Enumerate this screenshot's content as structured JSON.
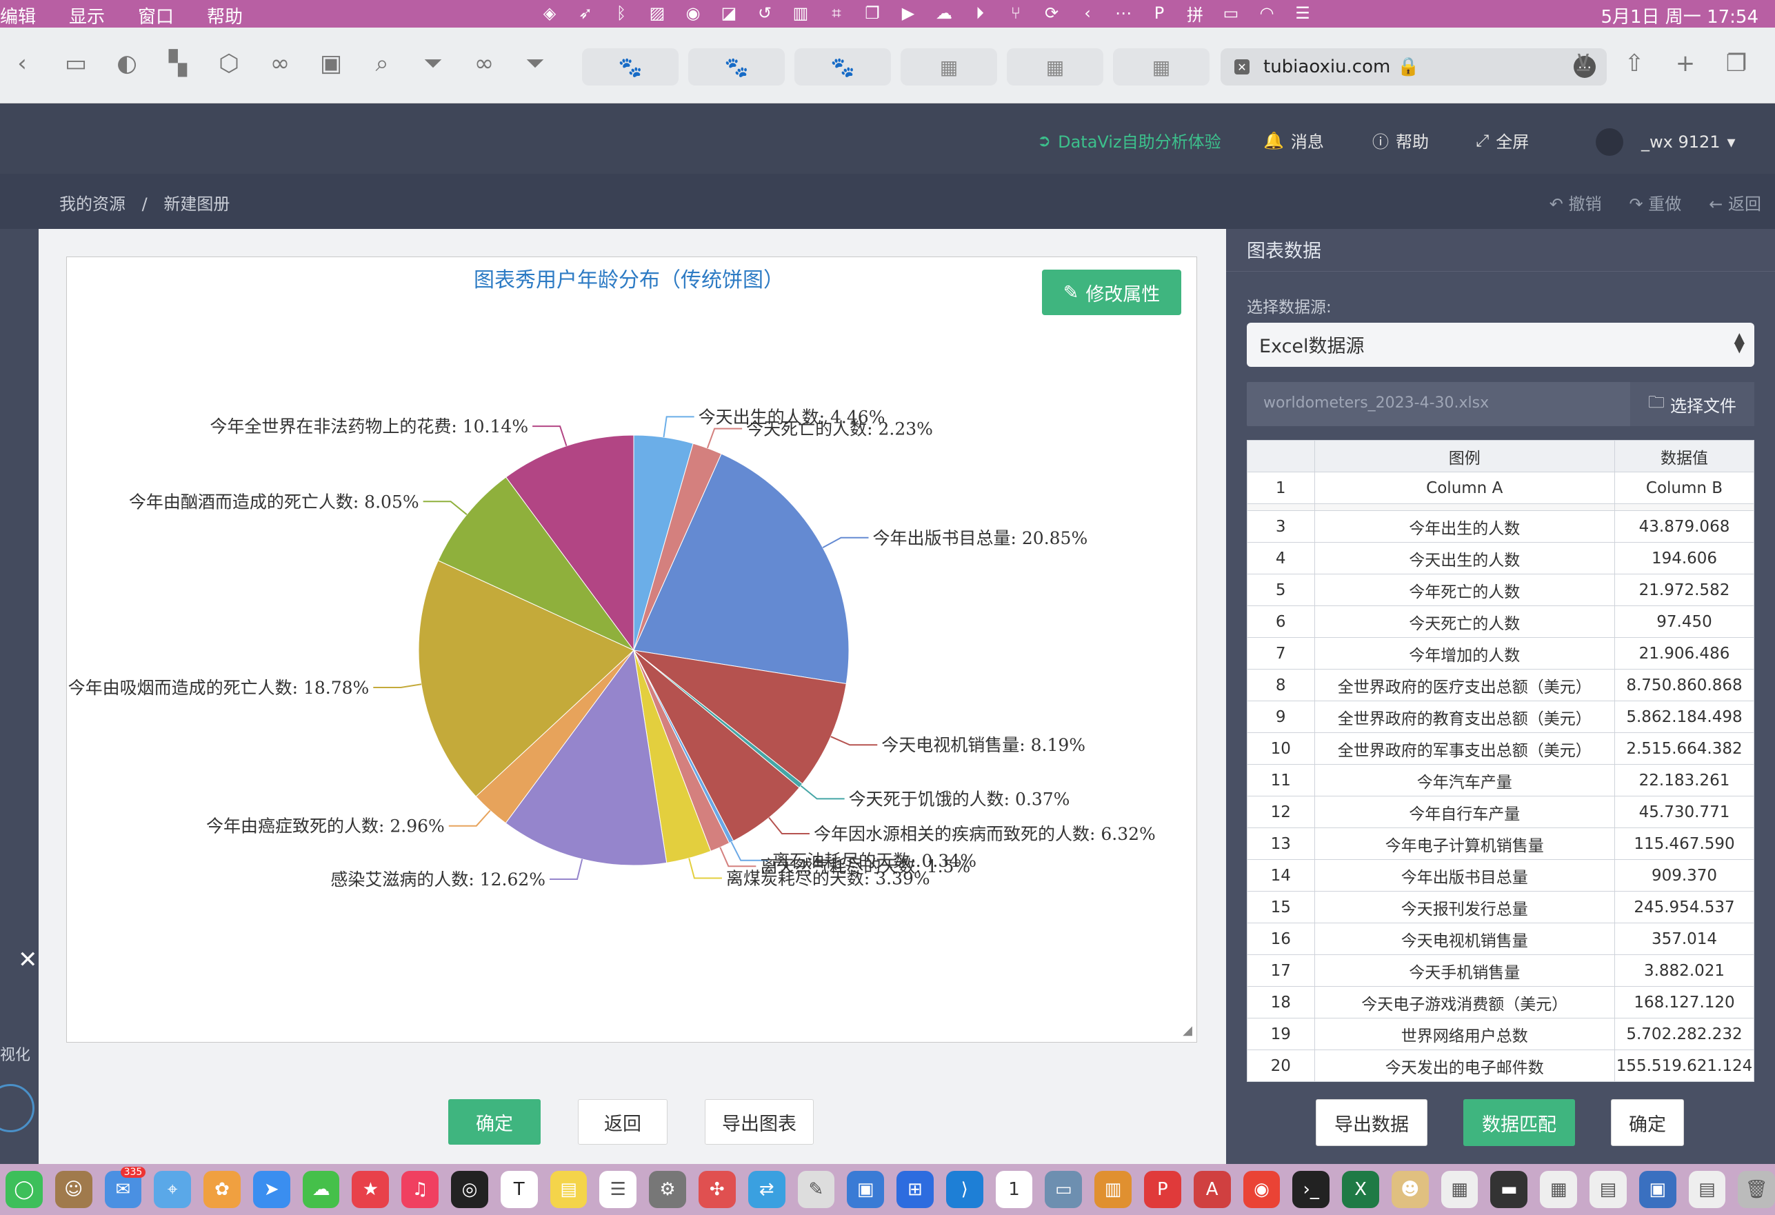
{
  "menubar": {
    "menus": [
      "编辑",
      "显示",
      "窗口",
      "帮助"
    ],
    "clock": "5月1日 周一 17:54"
  },
  "browser": {
    "url": "tubiaoxiu.com"
  },
  "app_header": {
    "dataviz": "DataViz自助分析体验",
    "messages": "消息",
    "help": "帮助",
    "fullscreen": "全屏",
    "user": "_wx 9121"
  },
  "breadcrumb": {
    "root": "我的资源",
    "separator": "/",
    "current": "新建图册",
    "undo": "撤销",
    "redo": "重做",
    "back": "返回"
  },
  "left_strip": {
    "close": "✕",
    "vertical_label": "视化"
  },
  "chart_panel": {
    "edit_button": "修改属性",
    "confirm": "确定",
    "back": "返回",
    "export": "导出图表"
  },
  "chart_data": {
    "type": "pie",
    "title": "图表秀用户年龄分布（传统饼图）",
    "slices": [
      {
        "label": "今天出生的人数: 4.46%",
        "value": 4.46,
        "color": "#6baee8"
      },
      {
        "label": "今天死亡的人数: 2.23%",
        "value": 2.23,
        "color": "#d4807e"
      },
      {
        "label": "今年出版书目总量: 20.85%",
        "value": 20.85,
        "color": "#648ad2"
      },
      {
        "label": "今天电视机销售量: 8.19%",
        "value": 8.19,
        "color": "#b5524f"
      },
      {
        "label": "今天死于饥饿的人数: 0.37%",
        "value": 0.37,
        "color": "#45a6a6"
      },
      {
        "label": "今年因水源相关的疾病而致死的人数: 6.32%",
        "value": 6.32,
        "color": "#b5524f"
      },
      {
        "label": "离石油耗尽的天数: 0.34%",
        "value": 0.34,
        "color": "#6aa8e6"
      },
      {
        "label": "离天然气耗尽的天数: 1.5%",
        "value": 1.5,
        "color": "#d4807e"
      },
      {
        "label": "离煤炭耗尽的天数: 3.39%",
        "value": 3.39,
        "color": "#e3cf3e"
      },
      {
        "label": "感染艾滋病的人数: 12.62%",
        "value": 12.62,
        "color": "#9585cc"
      },
      {
        "label": "今年由癌症致死的人数: 2.96%",
        "value": 2.96,
        "color": "#e7a35b"
      },
      {
        "label": "今年由吸烟而造成的死亡人数: 18.78%",
        "value": 18.78,
        "color": "#c4aa3a"
      },
      {
        "label": "今年由酗酒而造成的死亡人数: 8.05%",
        "value": 8.05,
        "color": "#8fb03c"
      },
      {
        "label": "今年全世界在非法药物上的花费: 10.14%",
        "value": 10.14,
        "color": "#b24584"
      }
    ]
  },
  "right_panel": {
    "title": "图表数据",
    "source_label": "选择数据源:",
    "source_value": "Excel数据源",
    "file_name": "worldometers_2023-4-30.xlsx",
    "file_button": "选择文件",
    "table": {
      "headers": [
        "",
        "图例",
        "数据值"
      ],
      "row1": [
        "1",
        "Column A",
        "Column B"
      ],
      "rows": [
        [
          "3",
          "今年出生的人数",
          "43.879.068"
        ],
        [
          "4",
          "今天出生的人数",
          "194.606"
        ],
        [
          "5",
          "今年死亡的人数",
          "21.972.582"
        ],
        [
          "6",
          "今天死亡的人数",
          "97.450"
        ],
        [
          "7",
          "今年增加的人数",
          "21.906.486"
        ],
        [
          "8",
          "全世界政府的医疗支出总额（美元）",
          "8.750.860.868"
        ],
        [
          "9",
          "全世界政府的教育支出总额（美元）",
          "5.862.184.498"
        ],
        [
          "10",
          "全世界政府的军事支出总额（美元）",
          "2.515.664.382"
        ],
        [
          "11",
          "今年汽车产量",
          "22.183.261"
        ],
        [
          "12",
          "今年自行车产量",
          "45.730.771"
        ],
        [
          "13",
          "今年电子计算机销售量",
          "115.467.590"
        ],
        [
          "14",
          "今年出版书目总量",
          "909.370"
        ],
        [
          "15",
          "今天报刊发行总量",
          "245.954.537"
        ],
        [
          "16",
          "今天电视机销售量",
          "357.014"
        ],
        [
          "17",
          "今天手机销售量",
          "3.882.021"
        ],
        [
          "18",
          "今天电子游戏消费额（美元）",
          "168.127.120"
        ],
        [
          "19",
          "世界网络用户总数",
          "5.702.282.232"
        ],
        [
          "20",
          "今天发出的电子邮件数",
          "155.519.621.124"
        ]
      ]
    },
    "export_data": "导出数据",
    "match_data": "数据匹配",
    "confirm": "确定"
  },
  "dock": {
    "mail_badge": "335",
    "calendar_day": "1"
  }
}
